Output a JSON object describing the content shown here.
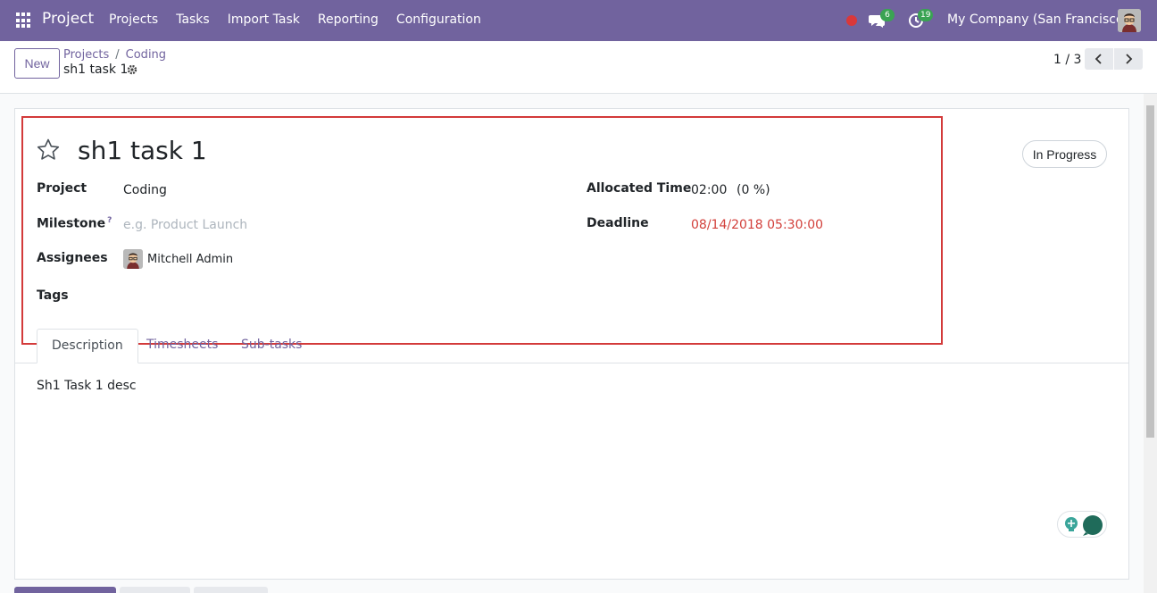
{
  "navbar": {
    "brand": "Project",
    "menu": [
      "Projects",
      "Tasks",
      "Import Task",
      "Reporting",
      "Configuration"
    ],
    "chat_count": "6",
    "activity_count": "19",
    "company": "My Company (San Francisco)"
  },
  "control_panel": {
    "new_label": "New",
    "breadcrumb": [
      "Projects",
      "Coding"
    ],
    "record_title": "sh1 task 1",
    "pager": "1 / 3"
  },
  "form": {
    "status": "In Progress",
    "task_name": "sh1 task 1",
    "fields": {
      "project_label": "Project",
      "project_value": "Coding",
      "milestone_label": "Milestone",
      "milestone_help": "?",
      "milestone_placeholder": "e.g. Product Launch",
      "assignees_label": "Assignees",
      "assignee": "Mitchell Admin",
      "tags_label": "Tags",
      "allocated_label": "Allocated Time",
      "allocated_value": "02:00",
      "allocated_percent": "(0 %)",
      "deadline_label": "Deadline",
      "deadline_value": "08/14/2018 05:30:00"
    },
    "tabs": [
      "Description",
      "Timesheets",
      "Sub-tasks"
    ],
    "description": "Sh1 Task 1 desc"
  },
  "colors": {
    "brand": "#71639e",
    "badge": "#3aa353",
    "deadline": "#d23f3a",
    "highlight": "#d33a3a"
  }
}
